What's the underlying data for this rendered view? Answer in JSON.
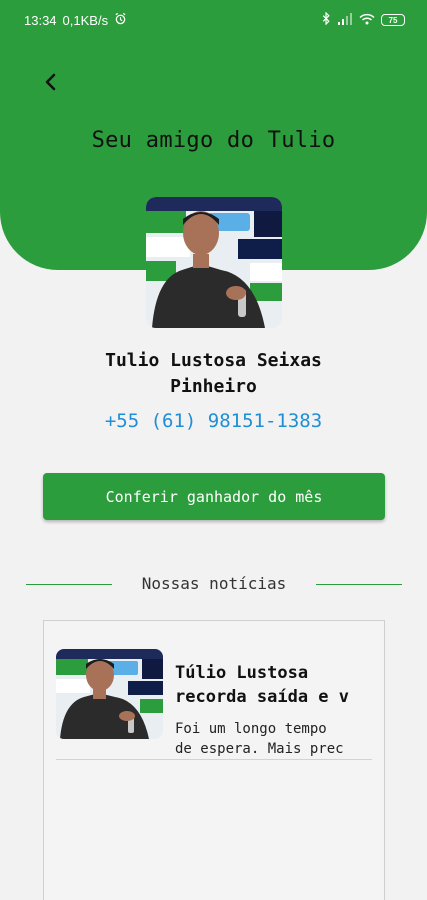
{
  "status_bar": {
    "time": "13:34",
    "speed": "0,1KB/s",
    "battery": "75"
  },
  "header": {
    "title": "Seu amigo do Tulio",
    "accent_color": "#2c9d3c"
  },
  "profile": {
    "name_line1": "Tulio Lustosa Seixas",
    "name_line2": "Pinheiro",
    "phone": "+55 (61) 98151-1383",
    "phone_color": "#1e8fd6"
  },
  "prize_button": {
    "label": "Conferir ganhador do mês"
  },
  "news": {
    "section_title": "Nossas notícias",
    "items": [
      {
        "title_line1": "Túlio Lustosa",
        "title_line2": "recorda saída e v",
        "excerpt_line1": "Foi um longo tempo",
        "excerpt_line2": "de espera. Mais prec"
      }
    ]
  },
  "icons": {
    "back": "chevron-left-icon",
    "alarm": "alarm-icon",
    "bluetooth": "bluetooth-icon",
    "signal": "signal-icon",
    "wifi": "wifi-icon"
  }
}
